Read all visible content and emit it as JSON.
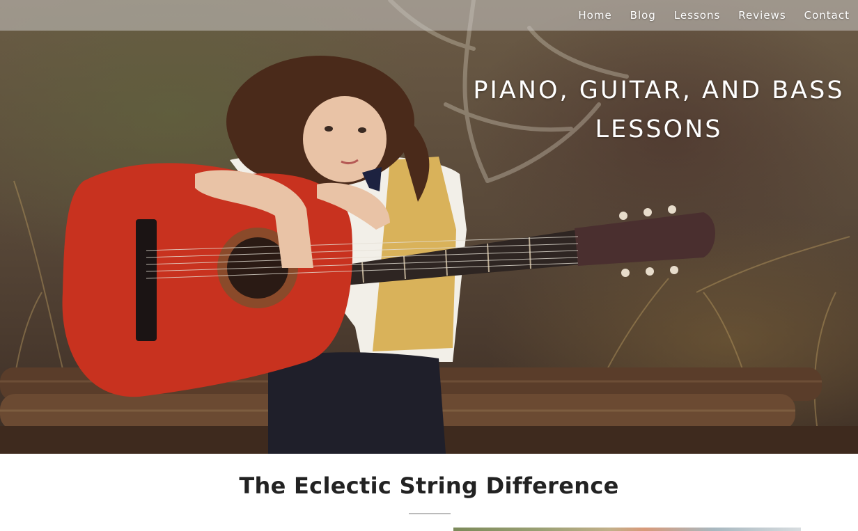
{
  "nav": {
    "items": [
      {
        "label": "Home"
      },
      {
        "label": "Blog"
      },
      {
        "label": "Lessons"
      },
      {
        "label": "Reviews"
      },
      {
        "label": "Contact"
      }
    ]
  },
  "hero": {
    "title": "PIANO, GUITAR, AND BASS LESSONS",
    "image_subject": "child-with-guitar-photo"
  },
  "section": {
    "title": "The Eclectic String Difference"
  },
  "colors": {
    "guitar_body": "#c8321f",
    "vest": "#d9b25a",
    "nav_bg": "#c8c6c4",
    "heading_text": "#222222"
  }
}
